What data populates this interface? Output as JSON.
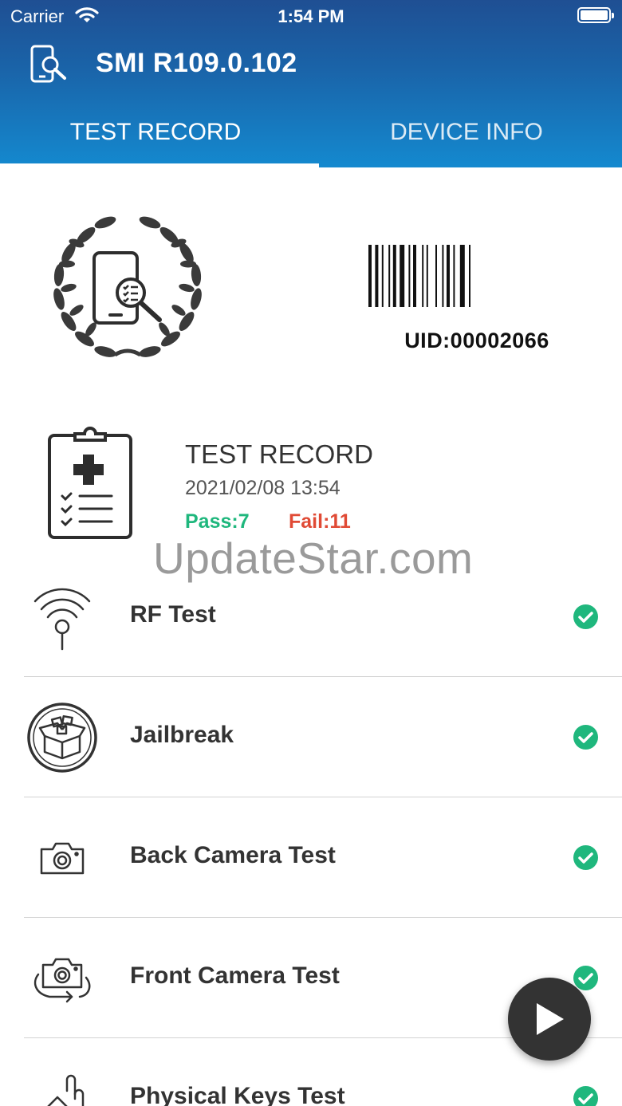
{
  "status_bar": {
    "carrier": "Carrier",
    "time": "1:54 PM"
  },
  "header": {
    "title": "SMI R109.0.102"
  },
  "tabs": [
    {
      "label": "TEST RECORD",
      "active": true
    },
    {
      "label": "DEVICE INFO",
      "active": false
    }
  ],
  "summary": {
    "uid": "UID:00002066",
    "record_title": "TEST RECORD",
    "date": "2021/02/08 13:54",
    "pass": "Pass:7",
    "fail": "Fail:11"
  },
  "watermark": "UpdateStar.com",
  "tests": [
    {
      "label": "RF Test",
      "icon": "wifi-signal-icon",
      "status": "pass"
    },
    {
      "label": "Jailbreak",
      "icon": "cydia-box-icon",
      "status": "pass"
    },
    {
      "label": "Back Camera Test",
      "icon": "camera-icon",
      "status": "pass"
    },
    {
      "label": "Front Camera Test",
      "icon": "camera-switch-icon",
      "status": "pass"
    },
    {
      "label": "Physical Keys Test",
      "icon": "hand-press-icon",
      "status": "pass"
    }
  ],
  "colors": {
    "pass": "#1fb77d",
    "fail": "#e04a35",
    "header_top": "#1f4f93",
    "header_bottom": "#1489cf",
    "fab": "#333333"
  }
}
